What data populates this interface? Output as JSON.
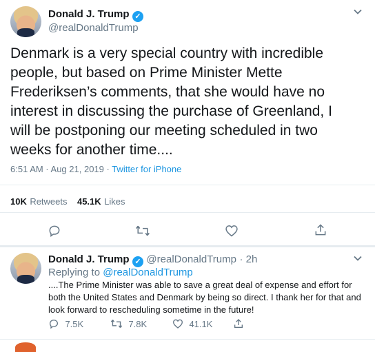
{
  "tweet": {
    "author_name": "Donald J. Trump",
    "author_handle": "@realDonaldTrump",
    "text": "Denmark is a very special country with incredible people, but based on Prime Minister Mette Frederiksen’s comments, that she would have no interest in discussing the purchase of Greenland, I will be postponing our meeting scheduled in two weeks for another time....",
    "time": "6:51 AM · Aug 21, 2019 · ",
    "source": "Twitter for iPhone",
    "retweets_count": "10K",
    "retweets_label": "Retweets",
    "likes_count": "45.1K",
    "likes_label": "Likes"
  },
  "reply": {
    "author_name": "Donald J. Trump",
    "author_handle": "@realDonaldTrump",
    "age": "· 2h",
    "replying_prefix": "Replying to ",
    "replying_to": "@realDonaldTrump",
    "text": "....The Prime Minister was able to save a great deal of expense and effort for both the United States and Denmark by being so direct. I thank her for that and look forward to rescheduling sometime in the future!",
    "reply_count": "7.5K",
    "retweet_count": "7.8K",
    "like_count": "41.1K"
  },
  "icons": {
    "verified": "verified-badge-icon",
    "chevron": "chevron-down-icon",
    "reply": "reply-icon",
    "retweet": "retweet-icon",
    "like": "heart-icon",
    "share": "share-icon"
  },
  "colors": {
    "accent": "#1da1f2",
    "link": "#1b95e0",
    "muted": "#657786",
    "divider": "#e6ecf0"
  }
}
